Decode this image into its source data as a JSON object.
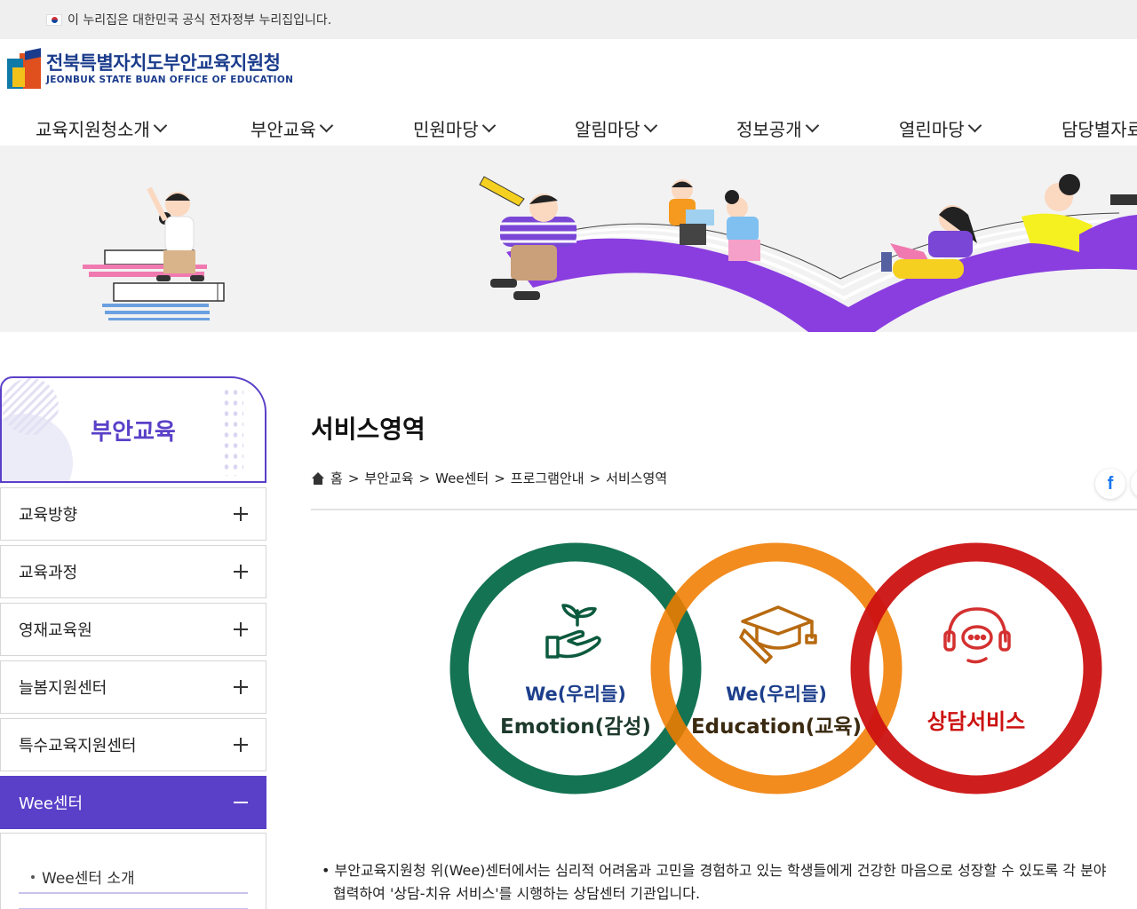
{
  "gov_banner": {
    "text": "이 누리집은 대한민국 공식 전자정부 누리집입니다."
  },
  "logo": {
    "name_ko": "전북특별자치도부안교육지원청",
    "name_en": "JEONBUK STATE BUAN OFFICE OF EDUCATION"
  },
  "gnb": [
    {
      "label": "교육지원청소개"
    },
    {
      "label": "부안교육"
    },
    {
      "label": "민원마당"
    },
    {
      "label": "알림마당"
    },
    {
      "label": "정보공개"
    },
    {
      "label": "열린마당"
    },
    {
      "label": "담당별자료"
    }
  ],
  "sidebar": {
    "title": "부안교육",
    "items": [
      {
        "label": "교육방향"
      },
      {
        "label": "교육과정"
      },
      {
        "label": "영재교육원"
      },
      {
        "label": "늘봄지원센터"
      },
      {
        "label": "특수교육지원센터"
      },
      {
        "label": "Wee센터"
      }
    ],
    "subitems": [
      {
        "label": "Wee센터 소개"
      }
    ]
  },
  "content": {
    "title": "서비스영역",
    "breadcrumb": [
      "홈",
      "부안교육",
      "Wee센터",
      "프로그램안내",
      "서비스영역"
    ],
    "share_facebook": "f",
    "circles": [
      {
        "line1": "We(우리들)",
        "line2": "Emotion(감성)",
        "color": "#0c6e4c",
        "icon": "plant-hand-icon"
      },
      {
        "line1": "We(우리들)",
        "line2": "Education(교육)",
        "color": "#f07c00",
        "icon": "graduation-cap-icon"
      },
      {
        "line1": "",
        "line2": "상담서비스",
        "color": "#cc1212",
        "icon": "headset-icon"
      }
    ],
    "description_line1": "• 부안교육지원청 위(Wee)센터에서는 심리적 어려움과 고민을 경험하고 있는 학생들에게 건강한 마음으로 성장할 수 있도록 각 분야",
    "description_line2": "협력하여 '상담-치유 서비스'를 시행하는 상담센터 기관입니다."
  },
  "colors": {
    "brand": "#1b3c8c",
    "accent": "#5a40c8",
    "hero_arc": "#8a3ee0"
  }
}
